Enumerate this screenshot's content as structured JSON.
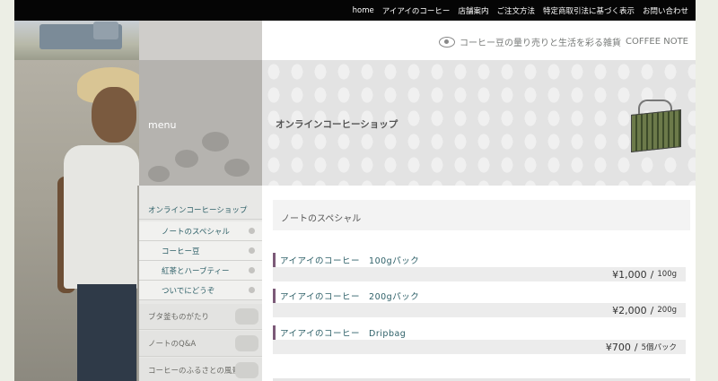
{
  "nav": {
    "items": [
      "home",
      "アイアイのコーヒー",
      "店舗案内",
      "ご注文方法",
      "特定商取引法に基づく表示",
      "お問い合わせ"
    ]
  },
  "brand": {
    "tagline": "コーヒー豆の量り売りと生活を彩る雑貨",
    "name": "COFFEE NOTE"
  },
  "menu": {
    "title": "menu",
    "items": [
      {
        "label": "オンラインコーヒーショップ"
      },
      {
        "label": "ノートのスペシャル"
      },
      {
        "label": "コーヒー豆"
      },
      {
        "label": "紅茶とハーブティー"
      },
      {
        "label": "ついでにどうぞ"
      },
      {
        "label": "ブタ釜ものがたり"
      },
      {
        "label": "ノートのQ&A"
      },
      {
        "label": "コーヒーのふるさとの風景"
      }
    ]
  },
  "hero": {
    "title": "オンラインコーヒーショップ"
  },
  "section": {
    "title": "ノートのスペシャル"
  },
  "products": [
    {
      "name": "アイアイのコーヒー　100gパック",
      "price": "¥1,000",
      "unit": "100g"
    },
    {
      "name": "アイアイのコーヒー　200gパック",
      "price": "¥2,000",
      "unit": "200g"
    },
    {
      "name": "アイアイのコーヒー　Dripbag",
      "price": "¥700",
      "unit": "5個パック"
    }
  ],
  "price_separator": "/",
  "colors": {
    "topbar": "#050505",
    "menu_link": "#2e6068",
    "product_marker": "#7c5a78"
  }
}
